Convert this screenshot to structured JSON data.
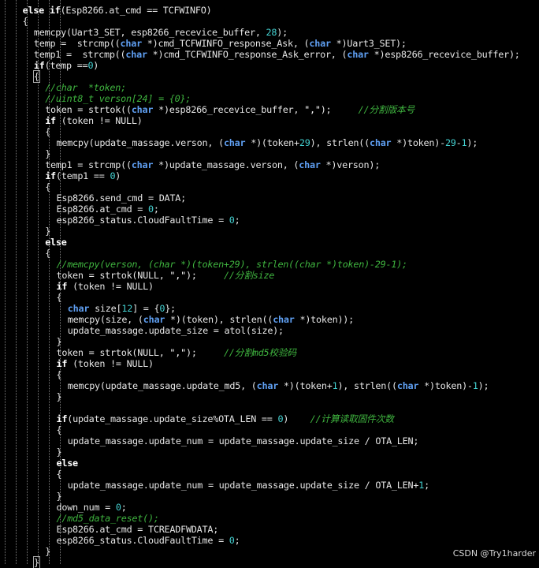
{
  "colors": {
    "background": "#000000",
    "keyword": "#ffffff",
    "type": "#5f9ff2",
    "number": "#44d2d2",
    "comment": "#3fb43f",
    "identifier": "#e6e6e6"
  },
  "watermark": "CSDN @Try1harder",
  "code_lines": [
    {
      "indent": 2,
      "tokens": [
        [
          "kw",
          "else "
        ],
        [
          "kw",
          "if"
        ],
        [
          "id",
          "(Esp8266.at_cmd == TCFWINFO)"
        ]
      ]
    },
    {
      "indent": 2,
      "tokens": [
        [
          "id",
          "{"
        ]
      ]
    },
    {
      "indent": 3,
      "tokens": [
        [
          "id",
          "memcpy(Uart3_SET, esp8266_recevice_buffer, "
        ],
        [
          "num",
          "28"
        ],
        [
          "id",
          ");"
        ]
      ]
    },
    {
      "indent": 3,
      "tokens": [
        [
          "id",
          "temp =  strcmp(("
        ],
        [
          "type",
          "char"
        ],
        [
          "id",
          " *)cmd_TCFWINFO_response_Ask, ("
        ],
        [
          "type",
          "char"
        ],
        [
          "id",
          " *)Uart3_SET);"
        ]
      ]
    },
    {
      "indent": 3,
      "tokens": [
        [
          "id",
          "temp1 =  strcmp(("
        ],
        [
          "type",
          "char"
        ],
        [
          "id",
          " *)cmd_TCFWINFO_response_Ask_error, ("
        ],
        [
          "type",
          "char"
        ],
        [
          "id",
          " *)esp8266_recevice_buffer);"
        ]
      ]
    },
    {
      "indent": 3,
      "tokens": [
        [
          "kw",
          "if"
        ],
        [
          "id",
          "(temp =="
        ],
        [
          "num",
          "0"
        ],
        [
          "id",
          ")"
        ]
      ]
    },
    {
      "indent": 3,
      "tokens": [
        [
          "cursor",
          "{"
        ]
      ]
    },
    {
      "indent": 4,
      "tokens": [
        [
          "cm",
          "//char  *token;"
        ]
      ]
    },
    {
      "indent": 4,
      "tokens": [
        [
          "cm",
          "//uint8_t verson[24] = {0};"
        ]
      ]
    },
    {
      "indent": 4,
      "tokens": [
        [
          "id",
          "token = strtok(("
        ],
        [
          "type",
          "char"
        ],
        [
          "id",
          " *)esp8266_recevice_buffer, "
        ],
        [
          "str",
          "\",\""
        ],
        [
          "id",
          ");     "
        ],
        [
          "cm",
          "//分割版本号"
        ]
      ]
    },
    {
      "indent": 4,
      "tokens": [
        [
          "kw",
          "if"
        ],
        [
          "id",
          " (token != NULL)"
        ]
      ]
    },
    {
      "indent": 4,
      "tokens": [
        [
          "id",
          "{"
        ]
      ]
    },
    {
      "indent": 5,
      "tokens": [
        [
          "id",
          "memcpy(update_massage.verson, ("
        ],
        [
          "type",
          "char"
        ],
        [
          "id",
          " *)(token+"
        ],
        [
          "num",
          "29"
        ],
        [
          "id",
          "), strlen(("
        ],
        [
          "type",
          "char"
        ],
        [
          "id",
          " *)token)-"
        ],
        [
          "num",
          "29"
        ],
        [
          "id",
          "-"
        ],
        [
          "num",
          "1"
        ],
        [
          "id",
          ");"
        ]
      ]
    },
    {
      "indent": 4,
      "tokens": [
        [
          "id",
          "}"
        ]
      ]
    },
    {
      "indent": 4,
      "tokens": [
        [
          "id",
          "temp1 = strcmp(("
        ],
        [
          "type",
          "char"
        ],
        [
          "id",
          " *)update_massage.verson, ("
        ],
        [
          "type",
          "char"
        ],
        [
          "id",
          " *)verson);"
        ]
      ]
    },
    {
      "indent": 4,
      "tokens": [
        [
          "kw",
          "if"
        ],
        [
          "id",
          "(temp1 == "
        ],
        [
          "num",
          "0"
        ],
        [
          "id",
          ")"
        ]
      ]
    },
    {
      "indent": 4,
      "tokens": [
        [
          "id",
          "{"
        ]
      ]
    },
    {
      "indent": 5,
      "tokens": [
        [
          "id",
          "Esp8266.send_cmd = DATA;"
        ]
      ]
    },
    {
      "indent": 5,
      "tokens": [
        [
          "id",
          "Esp8266.at_cmd = "
        ],
        [
          "num",
          "0"
        ],
        [
          "id",
          ";"
        ]
      ]
    },
    {
      "indent": 5,
      "tokens": [
        [
          "id",
          "esp8266_status.CloudFaultTime = "
        ],
        [
          "num",
          "0"
        ],
        [
          "id",
          ";"
        ]
      ]
    },
    {
      "indent": 4,
      "tokens": [
        [
          "id",
          "}"
        ]
      ]
    },
    {
      "indent": 4,
      "tokens": [
        [
          "kw",
          "else"
        ]
      ]
    },
    {
      "indent": 4,
      "tokens": [
        [
          "id",
          "{"
        ]
      ]
    },
    {
      "indent": 5,
      "tokens": [
        [
          "cm",
          "//memcpy(verson, (char *)(token+29), strlen((char *)token)-29-1);"
        ]
      ]
    },
    {
      "indent": 5,
      "tokens": [
        [
          "id",
          "token = strtok(NULL, "
        ],
        [
          "str",
          "\",\""
        ],
        [
          "id",
          ");     "
        ],
        [
          "cm",
          "//分割size"
        ]
      ]
    },
    {
      "indent": 5,
      "tokens": [
        [
          "kw",
          "if"
        ],
        [
          "id",
          " (token != NULL)"
        ]
      ]
    },
    {
      "indent": 5,
      "tokens": [
        [
          "id",
          "{"
        ]
      ]
    },
    {
      "indent": 6,
      "tokens": [
        [
          "type",
          "char"
        ],
        [
          "id",
          " size["
        ],
        [
          "num",
          "12"
        ],
        [
          "id",
          "] = {"
        ],
        [
          "num",
          "0"
        ],
        [
          "id",
          "};"
        ]
      ]
    },
    {
      "indent": 6,
      "tokens": [
        [
          "id",
          "memcpy(size, ("
        ],
        [
          "type",
          "char"
        ],
        [
          "id",
          " *)(token), strlen(("
        ],
        [
          "type",
          "char"
        ],
        [
          "id",
          " *)token));"
        ]
      ]
    },
    {
      "indent": 6,
      "tokens": [
        [
          "id",
          "update_massage.update_size = atol(size);"
        ]
      ]
    },
    {
      "indent": 5,
      "tokens": [
        [
          "id",
          "}"
        ]
      ]
    },
    {
      "indent": 5,
      "tokens": [
        [
          "id",
          "token = strtok(NULL, "
        ],
        [
          "str",
          "\",\""
        ],
        [
          "id",
          ");     "
        ],
        [
          "cm",
          "//分割md5校验码"
        ]
      ]
    },
    {
      "indent": 5,
      "tokens": [
        [
          "kw",
          "if"
        ],
        [
          "id",
          " (token != NULL)"
        ]
      ]
    },
    {
      "indent": 5,
      "tokens": [
        [
          "id",
          "{"
        ]
      ]
    },
    {
      "indent": 6,
      "tokens": [
        [
          "id",
          "memcpy(update_massage.update_md5, ("
        ],
        [
          "type",
          "char"
        ],
        [
          "id",
          " *)(token+"
        ],
        [
          "num",
          "1"
        ],
        [
          "id",
          "), strlen(("
        ],
        [
          "type",
          "char"
        ],
        [
          "id",
          " *)token)-"
        ],
        [
          "num",
          "1"
        ],
        [
          "id",
          ");"
        ]
      ]
    },
    {
      "indent": 5,
      "tokens": [
        [
          "id",
          "}"
        ]
      ]
    },
    {
      "indent": 5,
      "tokens": []
    },
    {
      "indent": 5,
      "tokens": [
        [
          "kw",
          "if"
        ],
        [
          "id",
          "(update_massage.update_size%OTA_LEN == "
        ],
        [
          "num",
          "0"
        ],
        [
          "id",
          ")    "
        ],
        [
          "cm",
          "//计算读取固件次数"
        ]
      ]
    },
    {
      "indent": 5,
      "tokens": [
        [
          "id",
          "{"
        ]
      ]
    },
    {
      "indent": 6,
      "tokens": [
        [
          "id",
          "update_massage.update_num = update_massage.update_size / OTA_LEN;"
        ]
      ]
    },
    {
      "indent": 5,
      "tokens": [
        [
          "id",
          "}"
        ]
      ]
    },
    {
      "indent": 5,
      "tokens": [
        [
          "kw",
          "else"
        ]
      ]
    },
    {
      "indent": 5,
      "tokens": [
        [
          "id",
          "{"
        ]
      ]
    },
    {
      "indent": 6,
      "tokens": [
        [
          "id",
          "update_massage.update_num = update_massage.update_size / OTA_LEN+"
        ],
        [
          "num",
          "1"
        ],
        [
          "id",
          ";"
        ]
      ]
    },
    {
      "indent": 5,
      "tokens": [
        [
          "id",
          "}"
        ]
      ]
    },
    {
      "indent": 5,
      "tokens": [
        [
          "id",
          "down_num = "
        ],
        [
          "num",
          "0"
        ],
        [
          "id",
          ";"
        ]
      ]
    },
    {
      "indent": 5,
      "tokens": [
        [
          "cm",
          "//md5_data_reset();"
        ]
      ]
    },
    {
      "indent": 5,
      "tokens": [
        [
          "id",
          "Esp8266.at_cmd = TCREADFWDATA;"
        ]
      ]
    },
    {
      "indent": 5,
      "tokens": [
        [
          "id",
          "esp8266_status.CloudFaultTime = "
        ],
        [
          "num",
          "0"
        ],
        [
          "id",
          ";"
        ]
      ]
    },
    {
      "indent": 4,
      "tokens": [
        [
          "id",
          "}"
        ]
      ]
    },
    {
      "indent": 3,
      "tokens": [
        [
          "cursor",
          "}"
        ]
      ]
    }
  ]
}
